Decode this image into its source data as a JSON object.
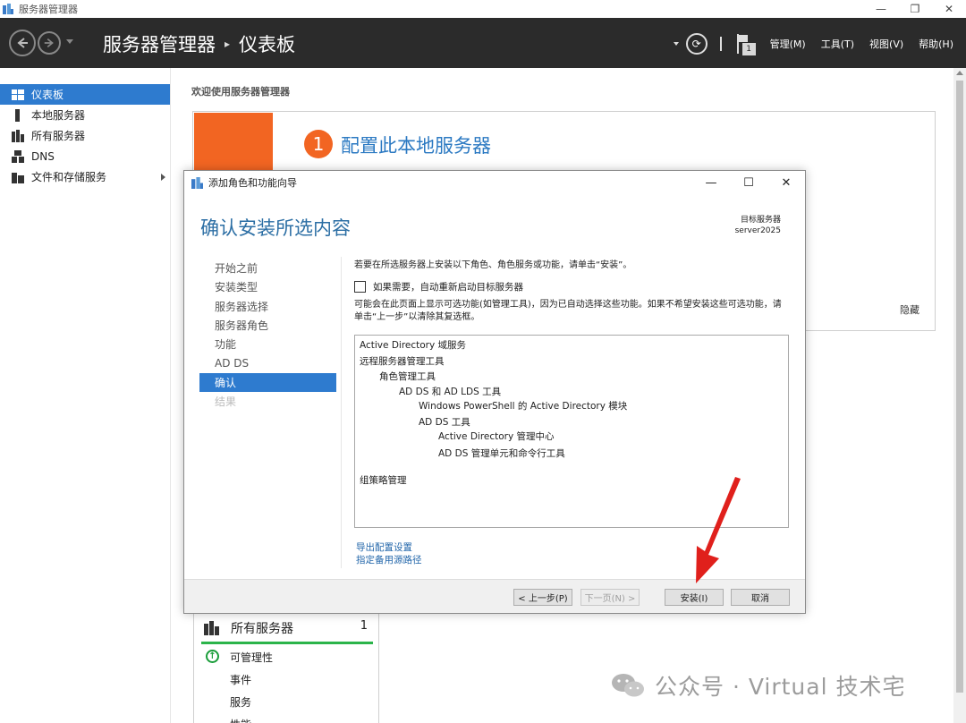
{
  "window": {
    "title": "服务器管理器"
  },
  "header": {
    "breadcrumb_root": "服务器管理器",
    "breadcrumb_sep": "▸",
    "breadcrumb_page": "仪表板",
    "flag_count": "1",
    "menus": [
      "管理(M)",
      "工具(T)",
      "视图(V)",
      "帮助(H)"
    ]
  },
  "sidebar": {
    "items": [
      {
        "label": "仪表板",
        "icon": "dashboard-icon"
      },
      {
        "label": "本地服务器",
        "icon": "server-icon"
      },
      {
        "label": "所有服务器",
        "icon": "servers-icon"
      },
      {
        "label": "DNS",
        "icon": "dns-icon"
      },
      {
        "label": "文件和存储服务",
        "icon": "storage-icon"
      }
    ]
  },
  "main": {
    "welcome": "欢迎使用服务器管理器",
    "step_number": "1",
    "step_label": "配置此本地服务器",
    "hide_label": "隐藏",
    "all_servers": {
      "title": "所有服务器",
      "count": "1",
      "rows": [
        "可管理性",
        "事件",
        "服务",
        "性能"
      ]
    }
  },
  "dialog": {
    "title": "添加角色和功能向导",
    "heading": "确认安装所选内容",
    "target_label": "目标服务器",
    "target_value": "server2025",
    "steps": [
      "开始之前",
      "安装类型",
      "服务器选择",
      "服务器角色",
      "功能",
      "AD DS",
      "确认",
      "结果"
    ],
    "intro": "若要在所选服务器上安装以下角色、角色服务或功能，请单击“安装”。",
    "checkbox_label": "如果需要，自动重新启动目标服务器",
    "note": "可能会在此页面上显示可选功能(如管理工具)，因为已自动选择这些功能。如果不希望安装这些可选功能，请单击“上一步”以清除其复选框。",
    "features": [
      "Active Directory 域服务",
      "远程服务器管理工具",
      "角色管理工具",
      "AD DS 和 AD LDS 工具",
      "Windows PowerShell 的 Active Directory 模块",
      "AD DS 工具",
      "Active Directory 管理中心",
      "AD DS 管理单元和命令行工具",
      "组策略管理"
    ],
    "links": [
      "导出配置设置",
      "指定备用源路径"
    ],
    "buttons": {
      "prev": "< 上一步(P)",
      "next": "下一页(N) >",
      "install": "安装(I)",
      "cancel": "取消"
    }
  },
  "watermark": "公众号 · Virtual 技术宅",
  "colors": {
    "accent": "#2e7bcf",
    "header_bg": "#2b2b2b",
    "orange": "#f26522",
    "heading_blue": "#2b6ea4",
    "arrow": "#e0201c"
  }
}
